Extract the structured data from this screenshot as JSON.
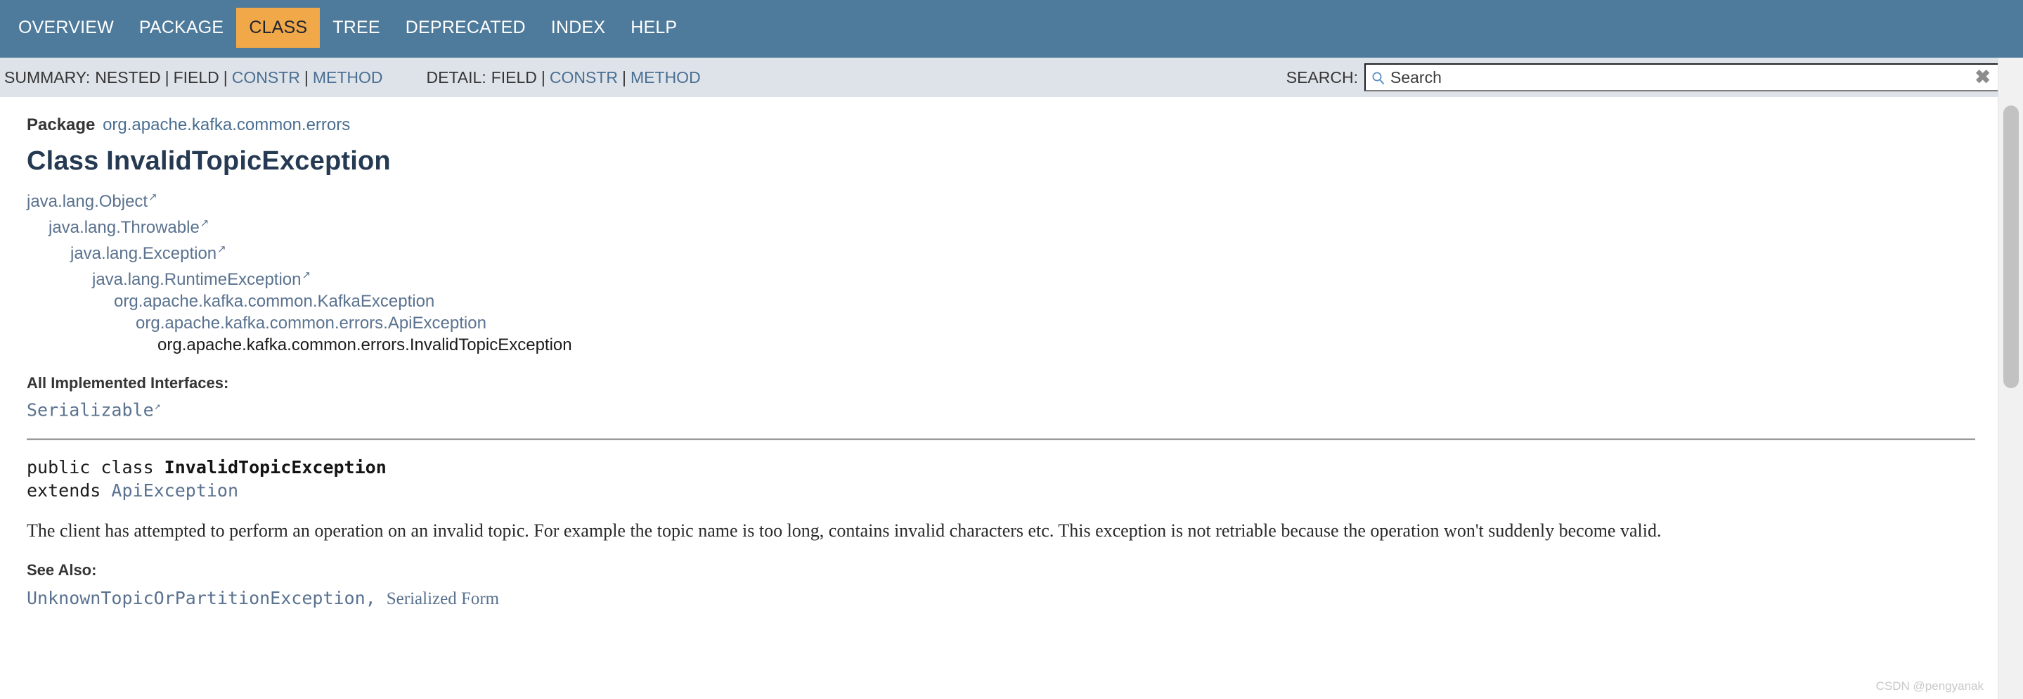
{
  "topnav": {
    "items": [
      {
        "label": "OVERVIEW",
        "active": false
      },
      {
        "label": "PACKAGE",
        "active": false
      },
      {
        "label": "CLASS",
        "active": true
      },
      {
        "label": "TREE",
        "active": false
      },
      {
        "label": "DEPRECATED",
        "active": false
      },
      {
        "label": "INDEX",
        "active": false
      },
      {
        "label": "HELP",
        "active": false
      }
    ],
    "colors": {
      "bar": "#4E7A9B",
      "active_bg": "#F0A848",
      "active_text": "#1f2430"
    }
  },
  "subnav": {
    "summary": {
      "label": "SUMMARY:",
      "items": [
        {
          "text": "NESTED",
          "link": false
        },
        {
          "text": "FIELD",
          "link": false
        },
        {
          "text": "CONSTR",
          "link": true
        },
        {
          "text": "METHOD",
          "link": true
        }
      ]
    },
    "detail": {
      "label": "DETAIL:",
      "items": [
        {
          "text": "FIELD",
          "link": false
        },
        {
          "text": "CONSTR",
          "link": true
        },
        {
          "text": "METHOD",
          "link": true
        }
      ]
    },
    "separator": "|",
    "search": {
      "label": "SEARCH:",
      "placeholder": "Search",
      "value": "",
      "icon": "search-icon",
      "clear_icon": "close-icon"
    }
  },
  "main": {
    "package_label": "Package",
    "package_name": "org.apache.kafka.common.errors",
    "class_title": "Class InvalidTopicException",
    "inheritance": [
      {
        "text": "java.lang.Object",
        "external": true,
        "current": false,
        "indent": 0
      },
      {
        "text": "java.lang.Throwable",
        "external": true,
        "current": false,
        "indent": 1
      },
      {
        "text": "java.lang.Exception",
        "external": true,
        "current": false,
        "indent": 2
      },
      {
        "text": "java.lang.RuntimeException",
        "external": true,
        "current": false,
        "indent": 3
      },
      {
        "text": "org.apache.kafka.common.KafkaException",
        "external": false,
        "current": false,
        "indent": 4
      },
      {
        "text": "org.apache.kafka.common.errors.ApiException",
        "external": false,
        "current": false,
        "indent": 5
      },
      {
        "text": "org.apache.kafka.common.errors.InvalidTopicException",
        "external": false,
        "current": true,
        "indent": 6
      }
    ],
    "interfaces_heading": "All Implemented Interfaces:",
    "interfaces": [
      {
        "text": "Serializable",
        "external": true
      }
    ],
    "signature": {
      "modifiers": "public class ",
      "name": "InvalidTopicException",
      "extends_keyword": "extends ",
      "superclass": "ApiException"
    },
    "description": "The client has attempted to perform an operation on an invalid topic. For example the topic name is too long, contains invalid characters etc. This exception is not retriable because the operation won't suddenly become valid.",
    "see_also_heading": "See Also:",
    "see_also": {
      "first": "UnknownTopicOrPartitionException",
      "comma": ", ",
      "second": "Serialized Form"
    }
  },
  "watermark": "CSDN @pengyanak"
}
